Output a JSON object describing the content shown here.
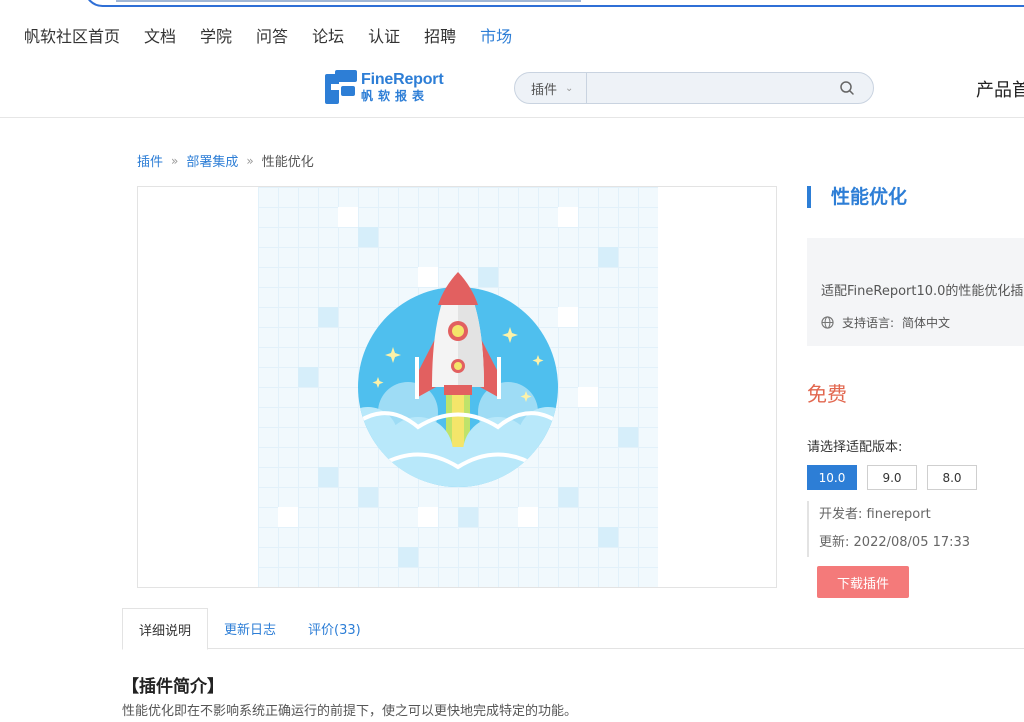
{
  "top_nav": {
    "items": [
      {
        "label": "帆软社区首页"
      },
      {
        "label": "文档"
      },
      {
        "label": "学院"
      },
      {
        "label": "问答"
      },
      {
        "label": "论坛"
      },
      {
        "label": "认证"
      },
      {
        "label": "招聘"
      },
      {
        "label": "市场",
        "active": true
      }
    ]
  },
  "header": {
    "logo_en": "FineReport",
    "logo_cn": "帆软报表",
    "search": {
      "category": "插件",
      "placeholder": "",
      "value": ""
    },
    "product_label": "产品首"
  },
  "breadcrumb": {
    "items": [
      "插件",
      "部署集成"
    ],
    "current": "性能优化"
  },
  "plugin": {
    "title": "性能优化",
    "description": "适配FineReport10.0的性能优化插",
    "language_label": "支持语言:",
    "language": "简体中文",
    "price": "免费",
    "version_label": "请选择适配版本:",
    "versions": [
      {
        "label": "10.0",
        "selected": true
      },
      {
        "label": "9.0",
        "selected": false
      },
      {
        "label": "8.0",
        "selected": false
      }
    ],
    "developer_label": "开发者:",
    "developer": "finereport",
    "updated_label": "更新:",
    "updated": "2022/08/05 17:33",
    "download_label": "下载插件"
  },
  "tabs": [
    {
      "label": "详细说明",
      "active": true
    },
    {
      "label": "更新日志",
      "active": false
    },
    {
      "label": "评价(33)",
      "active": false
    }
  ],
  "intro": {
    "title": "【插件简介】",
    "body": "性能优化即在不影响系统正确运行的前提下，使之可以更快地完成特定的功能。"
  },
  "colors": {
    "accent": "#2d7ed6",
    "price": "#e2674f",
    "download": "#f47a7a"
  }
}
